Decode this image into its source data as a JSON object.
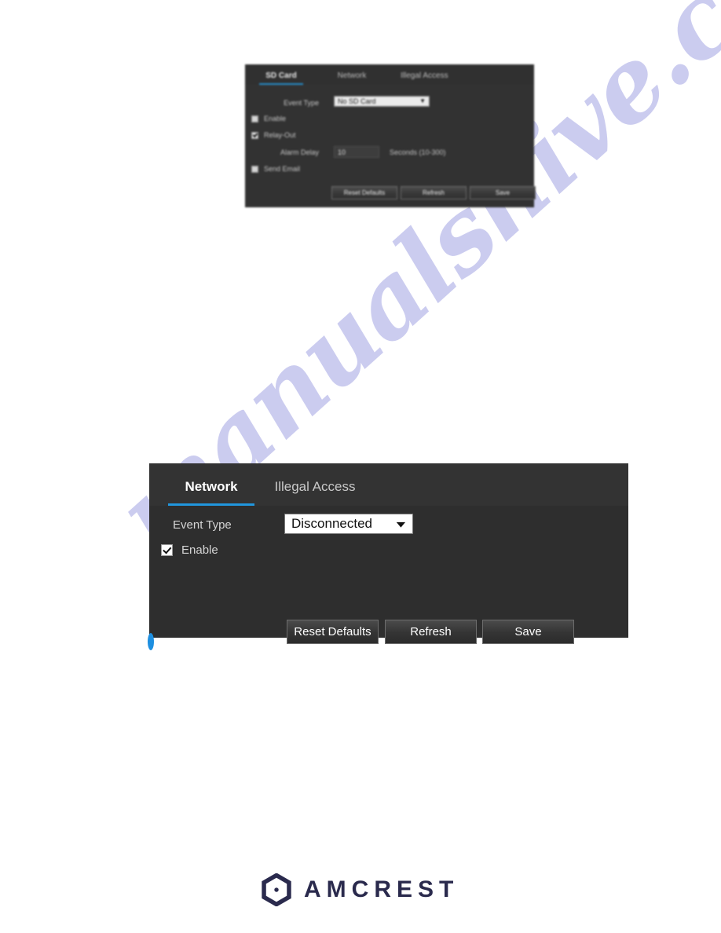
{
  "page": {
    "background_color": "#ffffff",
    "accent_color": "#2196dd",
    "panel_color": "#2e2e2e",
    "panel_header_color": "#333333"
  },
  "watermark": {
    "text": "manualshive.com",
    "color": "#bfc0ec"
  },
  "sd_card_panel": {
    "tabs": [
      {
        "label": "SD Card",
        "active": true
      },
      {
        "label": "Network",
        "active": false
      },
      {
        "label": "Illegal Access",
        "active": false
      }
    ],
    "event_type_label": "Event Type",
    "event_type_value": "No SD Card",
    "enable_label": "Enable",
    "enable_checked": false,
    "relay_out_label": "Relay-Out",
    "relay_out_checked": true,
    "alarm_delay_label": "Alarm Delay",
    "alarm_delay_value": "10",
    "alarm_delay_hint": "Seconds (10-300)",
    "send_email_label": "Send Email",
    "send_email_checked": false,
    "buttons": {
      "reset_defaults": "Reset Defaults",
      "refresh": "Refresh",
      "save": "Save"
    }
  },
  "network_panel": {
    "tabs": [
      {
        "label": "Network",
        "active": true
      },
      {
        "label": "Illegal Access",
        "active": false
      }
    ],
    "event_type_label": "Event Type",
    "event_type_value": "Disconnected",
    "enable_label": "Enable",
    "enable_checked": true,
    "buttons": {
      "reset_defaults": "Reset Defaults",
      "refresh": "Refresh",
      "save": "Save"
    }
  },
  "footer": {
    "brand": "AMCREST",
    "brand_color": "#2a2a4d"
  },
  "icons": {
    "chevron_down": "chevron-down-icon",
    "check": "check-icon",
    "hexagon_camera": "amcrest-hexagon-logo-icon"
  }
}
